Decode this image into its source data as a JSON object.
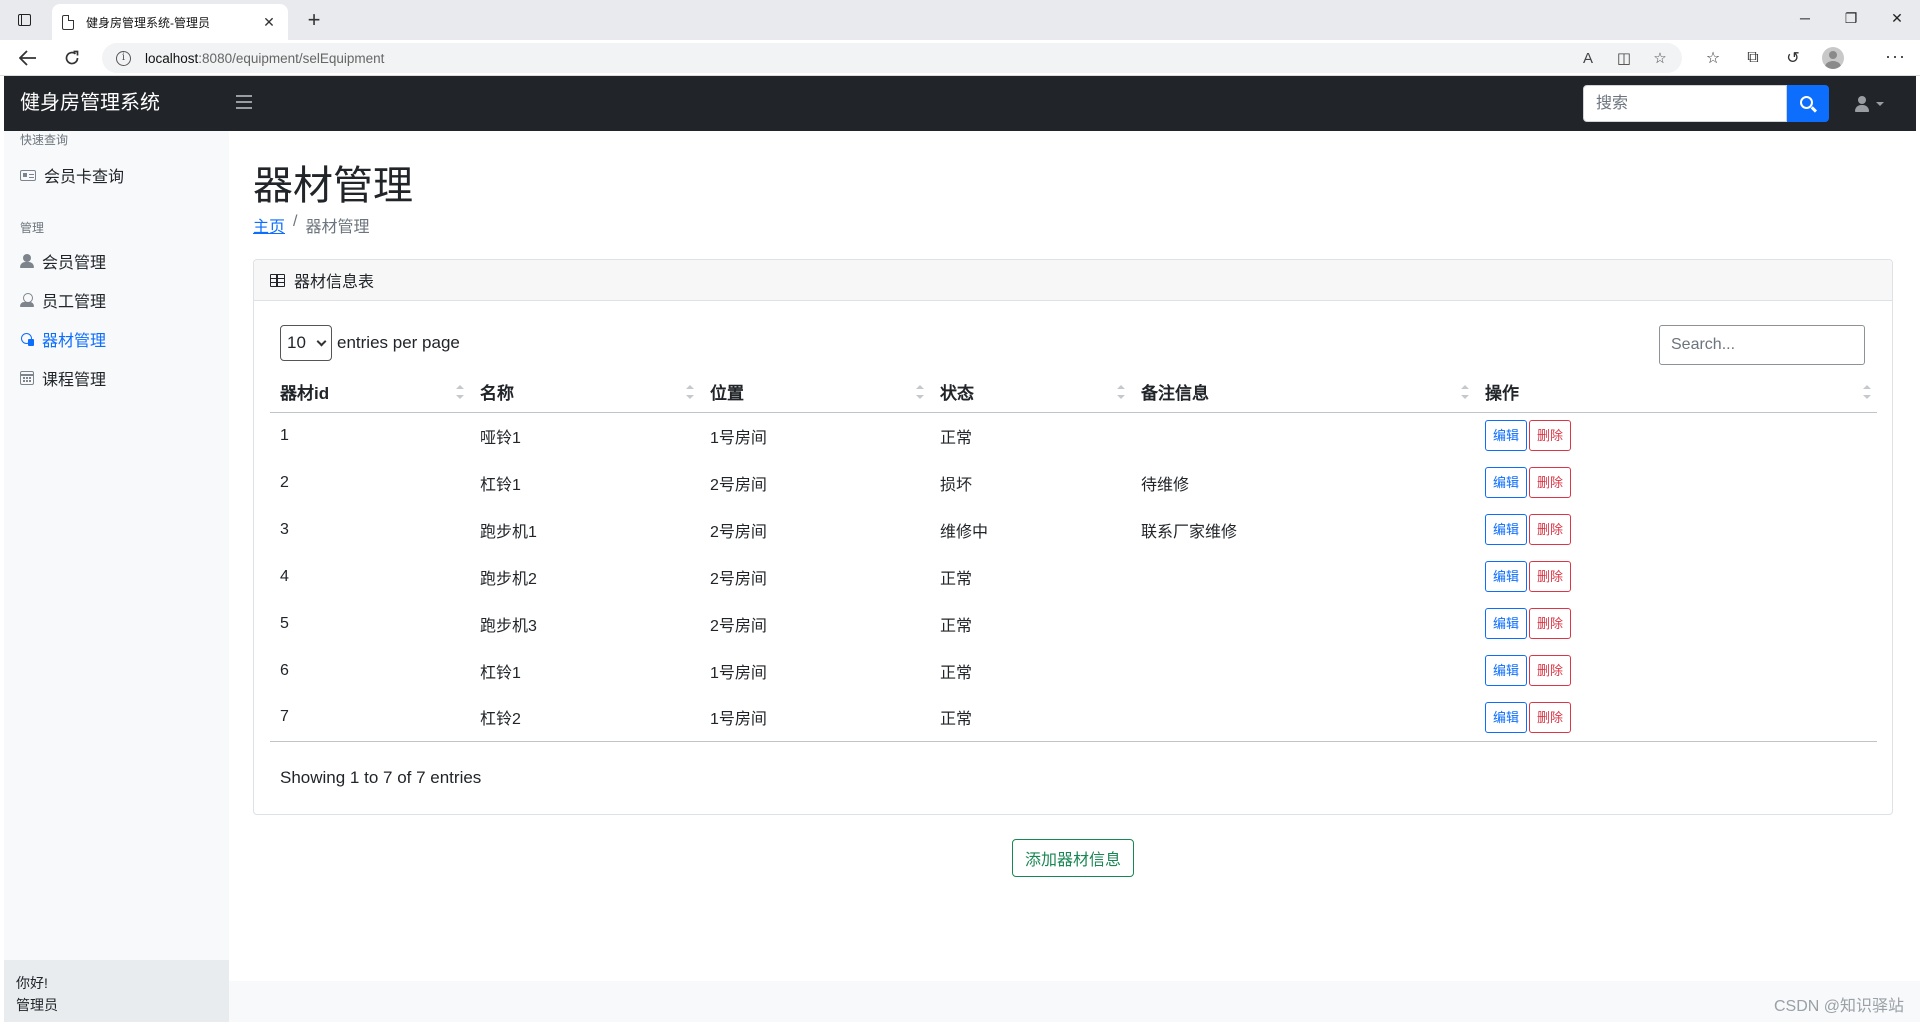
{
  "browser": {
    "tab_title": "健身房管理系统-管理员",
    "tab_close": "✕",
    "new_tab": "+",
    "url_host": "localhost",
    "url_path": ":8080/equipment/selEquipment",
    "window_controls": {
      "minimize": "─",
      "restore": "❐",
      "close": "✕"
    },
    "icons": [
      "tab-actions-icon",
      "back-arrow-icon",
      "reload-icon",
      "site-info-icon",
      "read-aloud-icon",
      "split-screen-icon",
      "add-favorite-icon",
      "favorites-icon",
      "collections-icon",
      "history-icon",
      "profile-avatar",
      "more-icon"
    ]
  },
  "navbar": {
    "brand": "健身房管理系统",
    "search_placeholder": "搜索",
    "accent_color": "#0d6efd",
    "background": "#212529"
  },
  "sidebar": {
    "sections": [
      {
        "heading": "快速查询",
        "items": [
          {
            "label": "会员卡查询",
            "icon": "card-icon",
            "active": false
          }
        ]
      },
      {
        "heading": "管理",
        "items": [
          {
            "label": "会员管理",
            "icon": "person-icon",
            "active": false
          },
          {
            "label": "员工管理",
            "icon": "staff-icon",
            "active": false
          },
          {
            "label": "器材管理",
            "icon": "equipment-icon",
            "active": true
          },
          {
            "label": "课程管理",
            "icon": "calendar-icon",
            "active": false
          }
        ]
      }
    ],
    "footer": {
      "greeting": "你好!",
      "role": "管理员"
    }
  },
  "main": {
    "title": "器材管理",
    "breadcrumb": {
      "home": "主页",
      "separator": "/",
      "current": "器材管理"
    },
    "card_title": "器材信息表",
    "per_page_value": "10",
    "per_page_suffix": "entries per page",
    "search_placeholder": "Search...",
    "columns": [
      "器材id",
      "名称",
      "位置",
      "状态",
      "备注信息",
      "操作"
    ],
    "rows": [
      {
        "id": "1",
        "name": "哑铃1",
        "location": "1号房间",
        "status": "正常",
        "note": ""
      },
      {
        "id": "2",
        "name": "杠铃1",
        "location": "2号房间",
        "status": "损坏",
        "note": "待维修"
      },
      {
        "id": "3",
        "name": "跑步机1",
        "location": "2号房间",
        "status": "维修中",
        "note": "联系厂家维修"
      },
      {
        "id": "4",
        "name": "跑步机2",
        "location": "2号房间",
        "status": "正常",
        "note": ""
      },
      {
        "id": "5",
        "name": "跑步机3",
        "location": "2号房间",
        "status": "正常",
        "note": ""
      },
      {
        "id": "6",
        "name": "杠铃1",
        "location": "1号房间",
        "status": "正常",
        "note": ""
      },
      {
        "id": "7",
        "name": "杠铃2",
        "location": "1号房间",
        "status": "正常",
        "note": ""
      }
    ],
    "edit_label": "编辑",
    "delete_label": "删除",
    "info": "Showing 1 to 7 of 7 entries",
    "add_button": "添加器材信息"
  },
  "watermark": "CSDN @知识驿站",
  "colors": {
    "primary": "#0d6efd",
    "danger": "#dc3545",
    "success": "#198754"
  }
}
